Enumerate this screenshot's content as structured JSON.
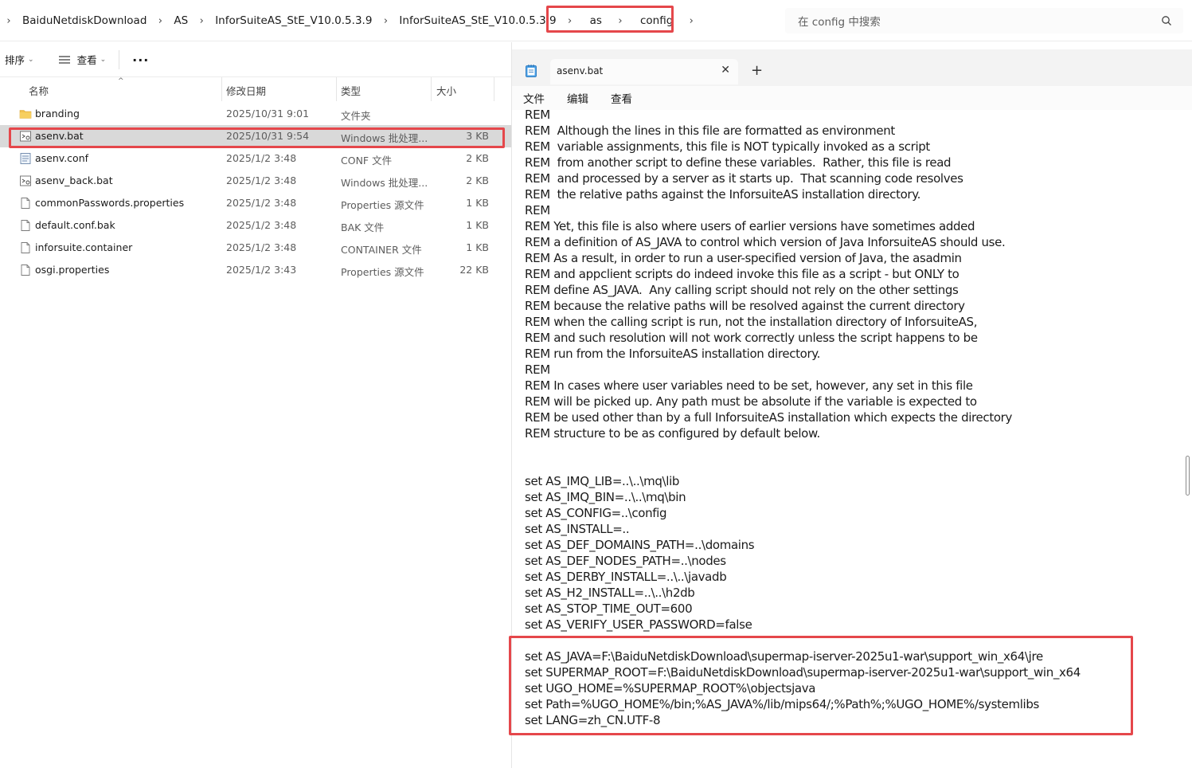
{
  "breadcrumb": [
    "BaiduNetdiskDownload",
    "AS",
    "InforSuiteAS_StE_V10.0.5.3.9",
    "InforSuiteAS_StE_V10.0.5.3.9",
    "as",
    "config"
  ],
  "search": {
    "placeholder": "在 config 中搜索"
  },
  "toolbar": {
    "sort_label": "排序",
    "view_label": "查看",
    "more_label": "..."
  },
  "columns": {
    "name": "名称",
    "date": "修改日期",
    "type": "类型",
    "size": "大小"
  },
  "files": [
    {
      "name": "branding",
      "date": "2025/10/31 9:01",
      "type": "文件夹",
      "size": "",
      "icon": "folder-icon"
    },
    {
      "name": "asenv.bat",
      "date": "2025/10/31 9:54",
      "type": "Windows 批处理...",
      "size": "3 KB",
      "icon": "batch-file-icon"
    },
    {
      "name": "asenv.conf",
      "date": "2025/1/2 3:48",
      "type": "CONF 文件",
      "size": "2 KB",
      "icon": "conf-file-icon"
    },
    {
      "name": "asenv_back.bat",
      "date": "2025/1/2 3:48",
      "type": "Windows 批处理...",
      "size": "2 KB",
      "icon": "batch-file-icon"
    },
    {
      "name": "commonPasswords.properties",
      "date": "2025/1/2 3:48",
      "type": "Properties 源文件",
      "size": "1 KB",
      "icon": "file-icon"
    },
    {
      "name": "default.conf.bak",
      "date": "2025/1/2 3:48",
      "type": "BAK 文件",
      "size": "1 KB",
      "icon": "file-icon"
    },
    {
      "name": "inforsuite.container",
      "date": "2025/1/2 3:48",
      "type": "CONTAINER 文件",
      "size": "1 KB",
      "icon": "file-icon"
    },
    {
      "name": "osgi.properties",
      "date": "2025/1/2 3:43",
      "type": "Properties 源文件",
      "size": "22 KB",
      "icon": "file-icon"
    }
  ],
  "selected_file_index": 1,
  "notepad": {
    "tab_title": "asenv.bat",
    "add_tab": "+",
    "close": "✕",
    "menu": [
      "文件",
      "编辑",
      "查看"
    ],
    "lines": [
      "REM",
      "REM  Although the lines in this file are formatted as environment",
      "REM  variable assignments, this file is NOT typically invoked as a script",
      "REM  from another script to define these variables.  Rather, this file is read",
      "REM  and processed by a server as it starts up.  That scanning code resolves",
      "REM  the relative paths against the InforsuiteAS installation directory.",
      "REM",
      "REM Yet, this file is also where users of earlier versions have sometimes added",
      "REM a definition of AS_JAVA to control which version of Java InforsuiteAS should use.",
      "REM As a result, in order to run a user-specified version of Java, the asadmin",
      "REM and appclient scripts do indeed invoke this file as a script - but ONLY to",
      "REM define AS_JAVA.  Any calling script should not rely on the other settings",
      "REM because the relative paths will be resolved against the current directory",
      "REM when the calling script is run, not the installation directory of InforsuiteAS,",
      "REM and such resolution will not work correctly unless the script happens to be",
      "REM run from the InforsuiteAS installation directory.",
      "REM",
      "REM In cases where user variables need to be set, however, any set in this file",
      "REM will be picked up. Any path must be absolute if the variable is expected to",
      "REM be used other than by a full InforsuiteAS installation which expects the directory",
      "REM structure to be as configured by default below.",
      "",
      "",
      "set AS_IMQ_LIB=..\\..\\mq\\lib",
      "set AS_IMQ_BIN=..\\..\\mq\\bin",
      "set AS_CONFIG=..\\config",
      "set AS_INSTALL=..",
      "set AS_DEF_DOMAINS_PATH=..\\domains",
      "set AS_DEF_NODES_PATH=..\\nodes",
      "set AS_DERBY_INSTALL=..\\..\\javadb",
      "set AS_H2_INSTALL=..\\..\\h2db",
      "set AS_STOP_TIME_OUT=600",
      "set AS_VERIFY_USER_PASSWORD=false",
      "",
      "set AS_JAVA=F:\\BaiduNetdiskDownload\\supermap-iserver-2025u1-war\\support_win_x64\\jre",
      "set SUPERMAP_ROOT=F:\\BaiduNetdiskDownload\\supermap-iserver-2025u1-war\\support_win_x64",
      "set UGO_HOME=%SUPERMAP_ROOT%\\objectsjava",
      "set Path=%UGO_HOME%/bin;%AS_JAVA%/lib/mips64/;%Path%;%UGO_HOME%/systemlibs",
      "set LANG=zh_CN.UTF-8"
    ]
  },
  "colors": {
    "highlight_box": "#e5474b",
    "selected_row": "#d9d9d9",
    "folder": "#f2c14e"
  }
}
